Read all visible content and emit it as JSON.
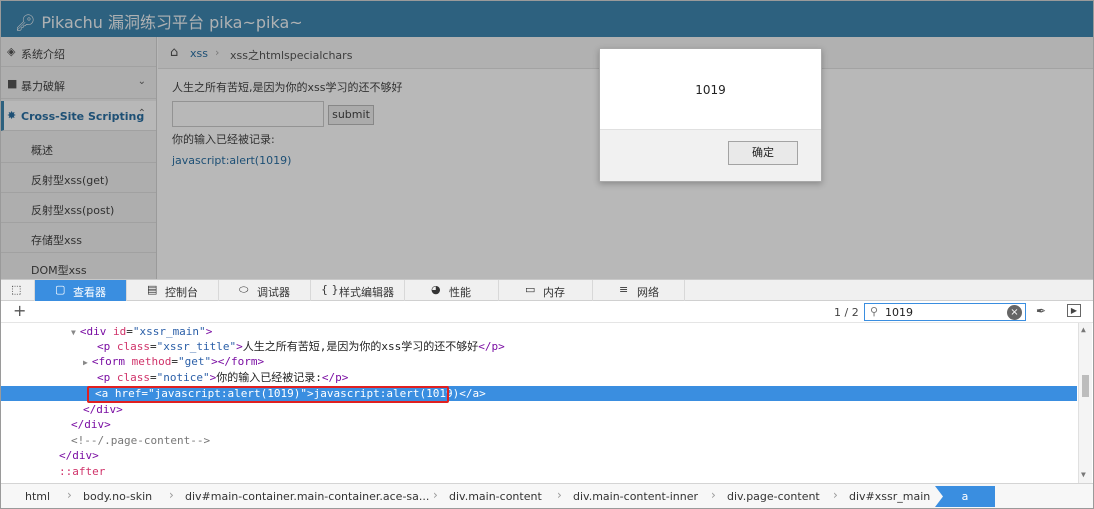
{
  "page": {
    "title": "Pikachu 漏洞练习平台 pika~pika~",
    "sidebar": [
      {
        "label": "系统介绍",
        "icon": "tag-icon"
      },
      {
        "label": "暴力破解",
        "icon": "lock-icon"
      },
      {
        "label": "Cross-Site Scripting",
        "icon": "bug-icon"
      },
      {
        "label": "概述"
      },
      {
        "label": "反射型xss(get)"
      },
      {
        "label": "反射型xss(post)"
      },
      {
        "label": "存储型xss"
      },
      {
        "label": "DOM型xss"
      }
    ],
    "breadcrumb": [
      "xss",
      "xss之htmlspecialchars"
    ],
    "content_title": "人生之所有苦短,是因为你的xss学习的还不够好",
    "submit_label": "submit",
    "notice": "你的输入已经被记录:",
    "link_text": "javascript:alert(1019)"
  },
  "dialog": {
    "message": "1019",
    "ok_label": "确定"
  },
  "devtools": {
    "tabs": [
      {
        "label": "查看器",
        "icon": "inspector-icon"
      },
      {
        "label": "控制台",
        "icon": "console-icon"
      },
      {
        "label": "调试器",
        "icon": "debugger-icon"
      },
      {
        "label": "样式编辑器",
        "icon": "style-editor-icon"
      },
      {
        "label": "性能",
        "icon": "performance-icon"
      },
      {
        "label": "内存",
        "icon": "memory-icon"
      },
      {
        "label": "网络",
        "icon": "network-icon"
      }
    ],
    "search": {
      "count": "1 / 2",
      "value": "1019"
    },
    "tree": {
      "l1": {
        "tag_open": "<div",
        "attr": "id",
        "value": "\"xssr_main\"",
        "close": ">"
      },
      "l2": {
        "tag_open": "<p",
        "attr": "class",
        "value": "\"xssr_title\"",
        "close": ">",
        "text": "人生之所有苦短,是因为你的xss学习的还不够好",
        "end": "</p>"
      },
      "l3": {
        "tag_open": "<form",
        "attr": "method",
        "value": "\"get\"",
        "close": ">",
        "end": "</form>"
      },
      "l4": {
        "tag_open": "<p",
        "attr": "class",
        "value": "\"notice\"",
        "close": ">",
        "text": "你的输入已经被记录:",
        "end": "</p>"
      },
      "l5": {
        "tag_open": "<a",
        "attr": "href",
        "value": "\"javascript:alert(1019)\"",
        "close": ">",
        "text": "javascript:alert(1019)",
        "end": "</a>"
      },
      "l6": "</div>",
      "l7": "</div>",
      "l8": "<!--/.page-content-->",
      "l9": "</div>",
      "l10": "::after"
    },
    "breadcrumbs": [
      "html",
      "body.no-skin",
      "div#main-container.main-container.ace-sa...",
      "div.main-content",
      "div.main-content-inner",
      "div.page-content",
      "div#xssr_main",
      "a"
    ]
  }
}
